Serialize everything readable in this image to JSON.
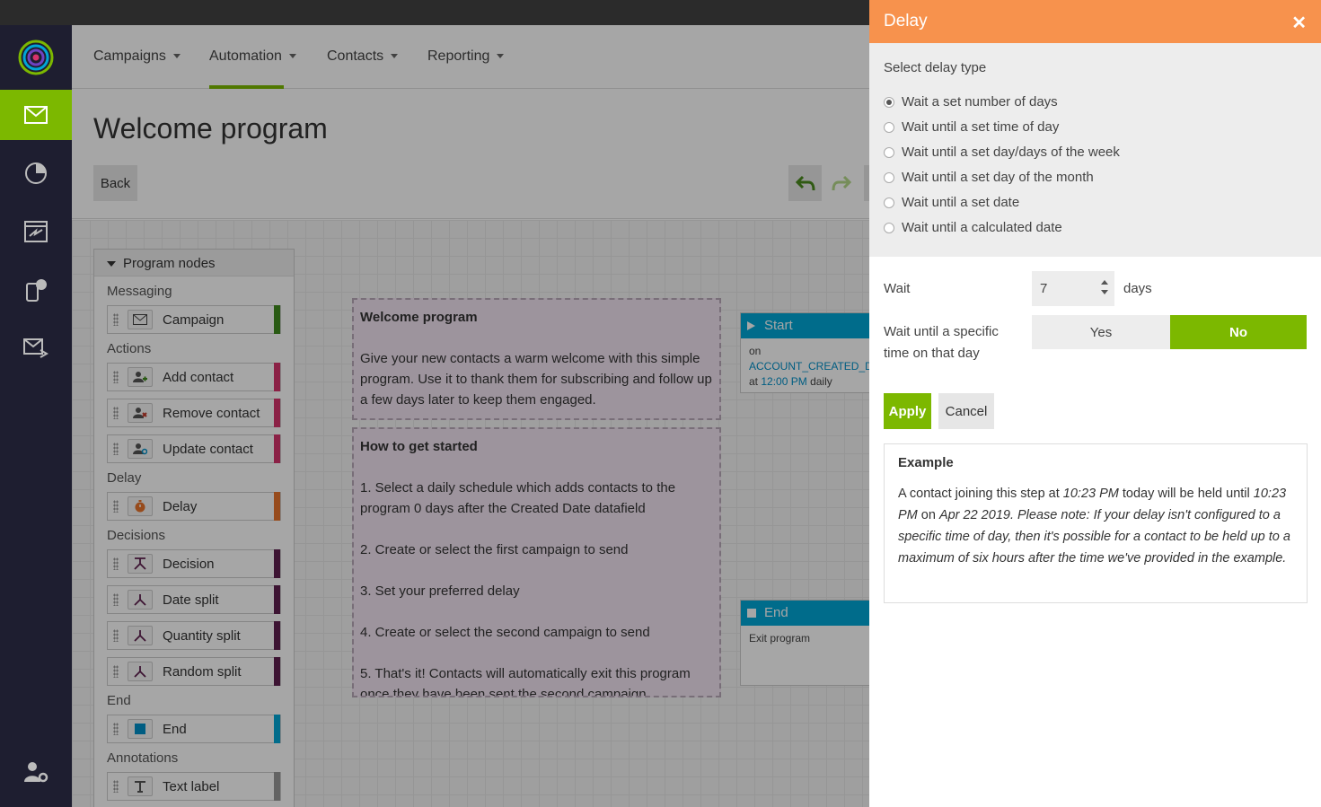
{
  "nav": {
    "items": [
      {
        "label": "Campaigns"
      },
      {
        "label": "Automation"
      },
      {
        "label": "Contacts"
      },
      {
        "label": "Reporting"
      }
    ],
    "active": "Automation"
  },
  "page": {
    "title": "Welcome program",
    "back_label": "Back"
  },
  "palette": {
    "header": "Program nodes",
    "categories": {
      "messaging": "Messaging",
      "actions": "Actions",
      "delay": "Delay",
      "decisions": "Decisions",
      "end": "End",
      "annotations": "Annotations"
    },
    "nodes": [
      {
        "label": "Campaign",
        "color": "#3f8a1e"
      },
      {
        "label": "Add contact",
        "color": "#d6336c"
      },
      {
        "label": "Remove contact",
        "color": "#d6336c"
      },
      {
        "label": "Update contact",
        "color": "#d6336c"
      },
      {
        "label": "Delay",
        "color": "#e8732b"
      },
      {
        "label": "Decision",
        "color": "#5e1f4f"
      },
      {
        "label": "Date split",
        "color": "#5e1f4f"
      },
      {
        "label": "Quantity split",
        "color": "#5e1f4f"
      },
      {
        "label": "Random split",
        "color": "#5e1f4f"
      },
      {
        "label": "End",
        "color": "#00a6d6"
      },
      {
        "label": "Text label",
        "color": "#999999"
      }
    ]
  },
  "notes": {
    "welcome": {
      "title": "Welcome program",
      "body": "Give your new contacts a warm welcome with this simple program.  Use it to thank them for subscribing and follow up a few days later to keep them engaged."
    },
    "started": {
      "title": "How to get started",
      "body": "1. Select a daily schedule which adds contacts to the program 0 days after the Created Date datafield\n\n2. Create or select the first campaign to send\n\n3. Set your preferred delay\n\n4. Create or select the second campaign to send\n\n5. That's it! Contacts will automatically exit this program once they have been sent the second campaign."
    }
  },
  "flow": {
    "start": {
      "title": "Start",
      "on": "on",
      "field": "ACCOUNT_CREATED_DAT",
      "at": "at",
      "time": "12:00 PM",
      "freq": "daily"
    },
    "end": {
      "title": "End",
      "body": "Exit program"
    }
  },
  "panel": {
    "title": "Delay",
    "select_label": "Select delay type",
    "options": [
      {
        "label": "Wait a set number of days",
        "selected": true
      },
      {
        "label": "Wait until a set time of day",
        "selected": false
      },
      {
        "label": "Wait until a set day/days of the week",
        "selected": false
      },
      {
        "label": "Wait until a set day of the month",
        "selected": false
      },
      {
        "label": "Wait until a set date",
        "selected": false
      },
      {
        "label": "Wait until a calculated date",
        "selected": false
      }
    ],
    "wait_label": "Wait",
    "wait_value": "7",
    "days_label": "days",
    "specific_label": "Wait until a specific time on that day",
    "yes_label": "Yes",
    "no_label": "No",
    "apply_label": "Apply",
    "cancel_label": "Cancel",
    "example": {
      "title": "Example",
      "t1": "A contact joining this step at ",
      "time1": "10:23 PM",
      "t2": " today will be held until ",
      "time2": "10:23 PM",
      "t3": " on ",
      "date": "Apr 22 2019",
      "note": ". Please note: If your delay isn't configured to a specific time of day, then it's possible for a contact to be held up to a maximum of six hours after the time we've provided in the example."
    }
  },
  "colors": {
    "accent_green": "#7cb800",
    "panel_orange": "#f7924d",
    "flow_blue": "#00a6d6",
    "rail_bg": "#1e1e30"
  }
}
